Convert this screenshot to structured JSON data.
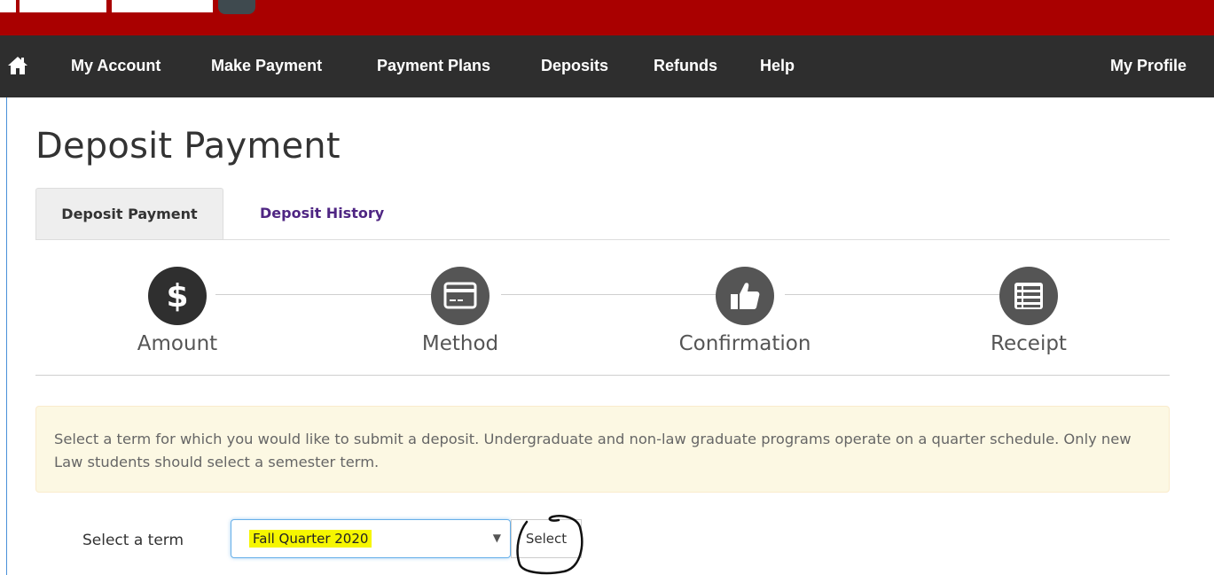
{
  "nav": {
    "items": [
      {
        "label": "My Account"
      },
      {
        "label": "Make Payment"
      },
      {
        "label": "Payment Plans"
      },
      {
        "label": "Deposits"
      },
      {
        "label": "Refunds"
      },
      {
        "label": "Help"
      }
    ],
    "profile": "My Profile"
  },
  "page": {
    "title": "Deposit Payment"
  },
  "tabs": [
    {
      "label": "Deposit Payment",
      "active": true
    },
    {
      "label": "Deposit History",
      "active": false
    }
  ],
  "steps": [
    {
      "label": "Amount",
      "icon": "dollar-icon",
      "active": true
    },
    {
      "label": "Method",
      "icon": "credit-card-icon",
      "active": false
    },
    {
      "label": "Confirmation",
      "icon": "thumbs-up-icon",
      "active": false
    },
    {
      "label": "Receipt",
      "icon": "list-icon",
      "active": false
    }
  ],
  "notice": {
    "text": "Select a term for which you would like to submit a deposit. Undergraduate and non-law graduate programs operate on a quarter schedule. Only new Law students should select a semester term."
  },
  "term": {
    "label": "Select a term",
    "selected": "Fall Quarter 2020",
    "button": "Select"
  },
  "colors": {
    "brand_red": "#a90000",
    "nav_bg": "#2e2e2e",
    "tab_link": "#4f2683",
    "notice_bg": "#fcf8e3",
    "highlight": "#f6f600"
  }
}
